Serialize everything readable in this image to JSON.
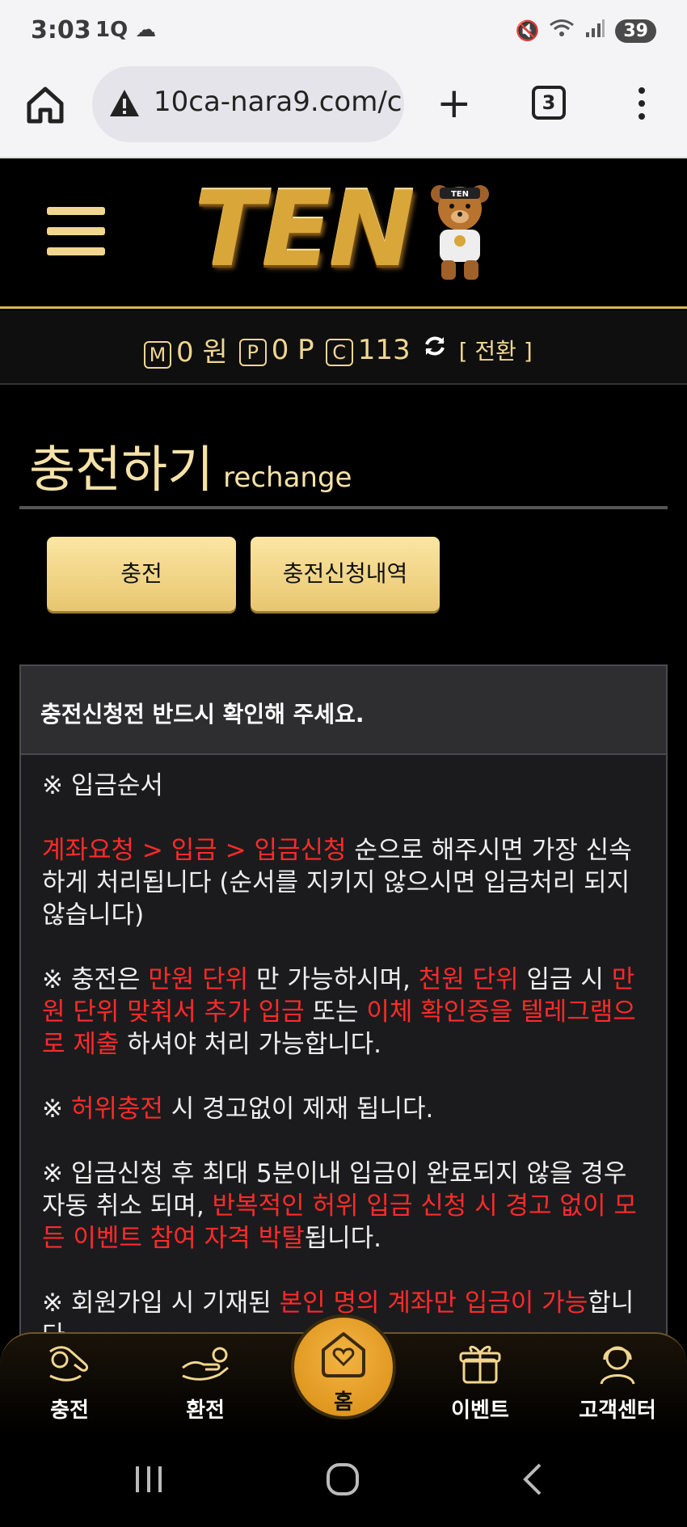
{
  "status": {
    "time": "3:03",
    "left_icons": "1Q ☁",
    "battery": "39"
  },
  "browser": {
    "url": "10ca-nara9.com/c",
    "tab_count": "3"
  },
  "header": {
    "logo_text": "TEN",
    "logo_badge": "TEN"
  },
  "points": {
    "m_icon": "M",
    "m_value": "0 원",
    "p_icon": "P",
    "p_value": "0 P",
    "c_icon": "C",
    "c_value": "113",
    "switch_label": "[ 전환 ]"
  },
  "page": {
    "title": "충전하기",
    "subtitle": "rechange"
  },
  "buttons": {
    "charge": "충전",
    "history": "충전신청내역"
  },
  "notice": {
    "heading": "충전신청전 반드시 확인해 주세요.",
    "p1": "※ 입금순서",
    "p2_red": "계좌요청 > 입금 > 입금신청",
    "p2_rest": " 순으로 해주시면 가장 신속하게 처리됩니다 (순서를 지키지 않으시면 입금처리 되지않습니다)",
    "p3_a": "※ 충전은 ",
    "p3_b": "만원 단위",
    "p3_c": " 만 가능하시며, ",
    "p3_d": "천원 단위",
    "p3_e": " 입금 시 ",
    "p3_f": "만원 단위 맞춰서 추가 입금",
    "p3_g": " 또는 ",
    "p3_h": "이체 확인증을 텔레그램으로 제출",
    "p3_i": " 하셔야 처리 가능합니다.",
    "p4_a": "※ ",
    "p4_b": "허위충전",
    "p4_c": " 시 경고없이 제재 됩니다.",
    "p5_a": "※ 입금신청 후 최대 5분이내 입금이 완료되지 않을 경우 자동 취소 되며, ",
    "p5_b": "반복적인 허위 입금 신청 시 경고 없이 모든 이벤트 참여 자격 박탈",
    "p5_c": "됩니다.",
    "p6_a": "※ 회원가입 시 기재된 ",
    "p6_b": "본인 명의 계좌만 입금이 가능",
    "p6_c": "합니다."
  },
  "tabbar": {
    "charge": "충전",
    "exchange": "환전",
    "home": "홈",
    "event": "이벤트",
    "support": "고객센터"
  },
  "colors": {
    "gold": "#f0d690",
    "red": "#ff2a2a",
    "button": "#f5d987"
  }
}
